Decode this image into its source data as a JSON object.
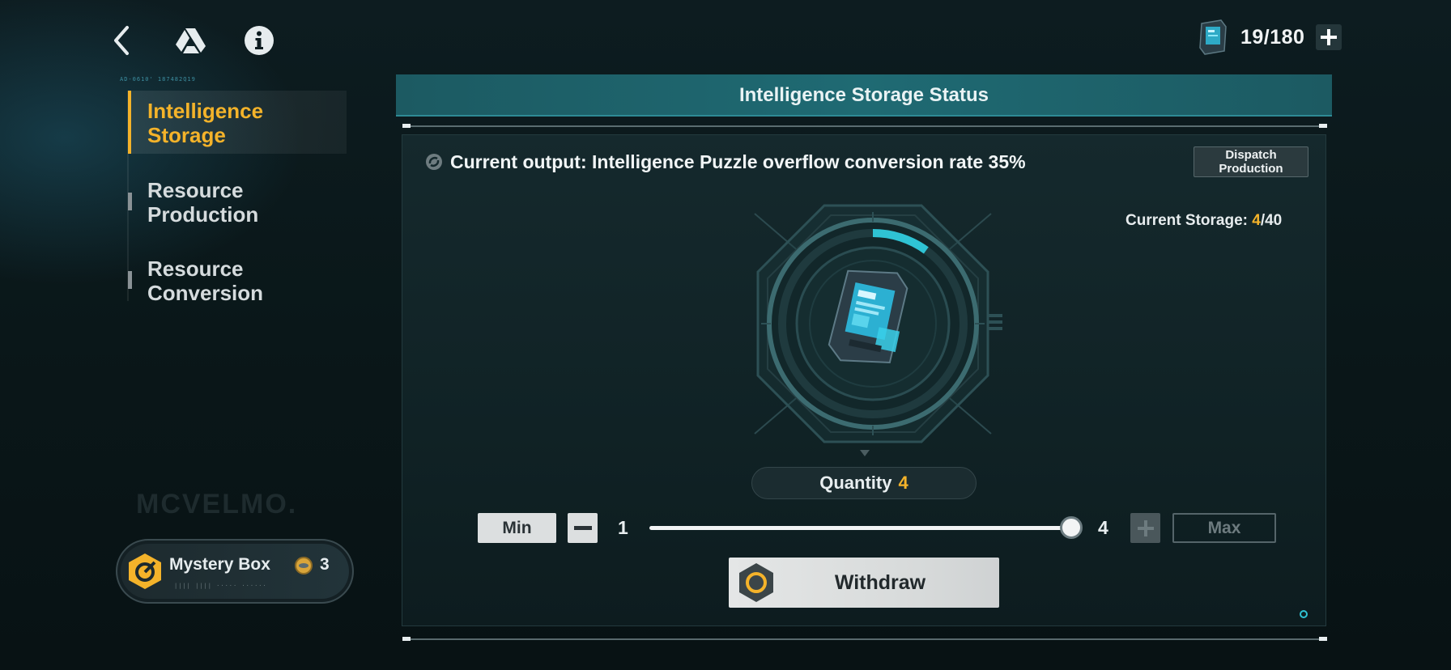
{
  "topbar": {
    "back_icon": "chevron-left-icon",
    "drive_icon": "triangle-logo-icon",
    "info_icon": "info-icon",
    "resource_count": "19/180",
    "add_icon": "plus-icon"
  },
  "sidebar": {
    "items": [
      {
        "label": "Intelligence\nStorage",
        "active": true
      },
      {
        "label": "Resource\nProduction",
        "active": false
      },
      {
        "label": "Resource\nConversion",
        "active": false
      }
    ],
    "watermark": "MCVELMO.",
    "mystery_box": {
      "label": "Mystery Box",
      "count": "3"
    }
  },
  "panel": {
    "title": "Intelligence Storage Status",
    "output_text": "Current output: Intelligence Puzzle overflow conversion rate 35%",
    "dispatch_label": "Dispatch\nProduction",
    "storage_label": "Current Storage:",
    "storage_current": "4",
    "storage_max": "/40",
    "storage_fill": 0.1,
    "quantity_label": "Quantity",
    "quantity_value": "4",
    "min_label": "Min",
    "max_label": "Max",
    "slider_min": "1",
    "slider_max": "4",
    "slider_value": 4,
    "withdraw_label": "Withdraw"
  },
  "colors": {
    "accent": "#f4b32a",
    "teal": "#2fc3d4",
    "header": "#1f6a73"
  }
}
